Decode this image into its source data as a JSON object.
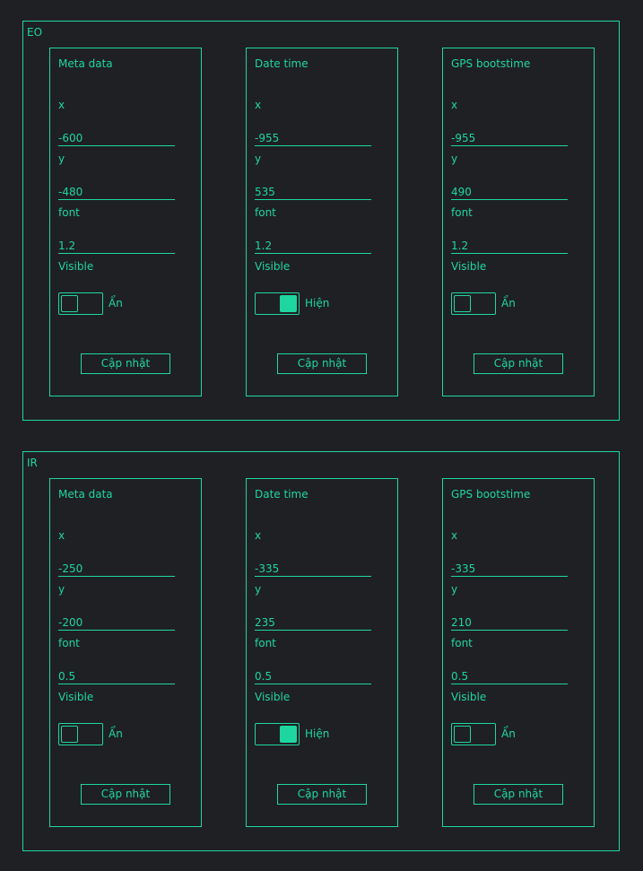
{
  "colors": {
    "accent": "#1ed7a0",
    "background": "#1f2024"
  },
  "sections": [
    {
      "title": "EO",
      "cards": [
        {
          "title": "Meta data",
          "x_label": "x",
          "x": "-600",
          "y_label": "y",
          "y": "-480",
          "font_label": "font",
          "font": "1.2",
          "visible_label": "Visible",
          "visible": false,
          "visible_text": "Ẩn",
          "button": "Cập nhật"
        },
        {
          "title": "Date time",
          "x_label": "x",
          "x": "-955",
          "y_label": "y",
          "y": "535",
          "font_label": "font",
          "font": "1.2",
          "visible_label": "Visible",
          "visible": true,
          "visible_text": "Hiện",
          "button": "Cập nhật"
        },
        {
          "title": "GPS bootstime",
          "x_label": "x",
          "x": "-955",
          "y_label": "y",
          "y": "490",
          "font_label": "font",
          "font": "1.2",
          "visible_label": "Visible",
          "visible": false,
          "visible_text": "Ẩn",
          "button": "Cập nhật"
        }
      ]
    },
    {
      "title": "IR",
      "cards": [
        {
          "title": "Meta data",
          "x_label": "x",
          "x": "-250",
          "y_label": "y",
          "y": "-200",
          "font_label": "font",
          "font": "0.5",
          "visible_label": "Visible",
          "visible": false,
          "visible_text": "Ẩn",
          "button": "Cập nhật"
        },
        {
          "title": "Date time",
          "x_label": "x",
          "x": "-335",
          "y_label": "y",
          "y": "235",
          "font_label": "font",
          "font": "0.5",
          "visible_label": "Visible",
          "visible": true,
          "visible_text": "Hiện",
          "button": "Cập nhật"
        },
        {
          "title": "GPS bootstime",
          "x_label": "x",
          "x": "-335",
          "y_label": "y",
          "y": "210",
          "font_label": "font",
          "font": "0.5",
          "visible_label": "Visible",
          "visible": false,
          "visible_text": "Ẩn",
          "button": "Cập nhật"
        }
      ]
    }
  ]
}
